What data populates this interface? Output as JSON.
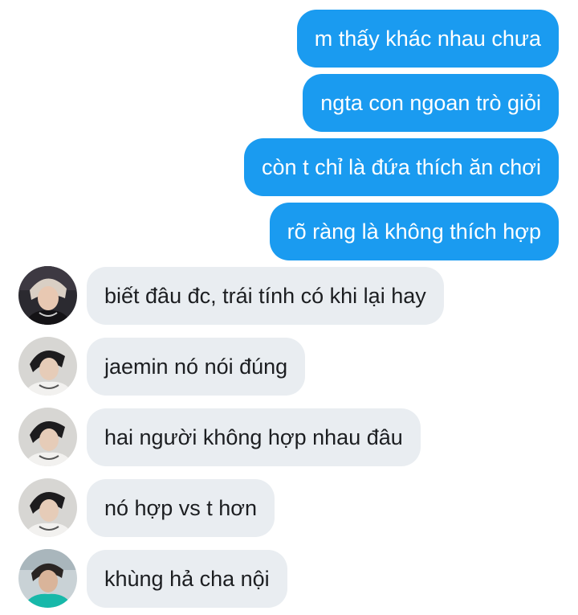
{
  "conversation": {
    "messages": [
      {
        "direction": "sent",
        "text": "m thấy khác nhau chưa"
      },
      {
        "direction": "sent",
        "text": "ngta con ngoan trò giỏi"
      },
      {
        "direction": "sent",
        "text": "còn t chỉ là đứa thích ăn chơi"
      },
      {
        "direction": "sent",
        "text": "rõ ràng là không thích hợp"
      },
      {
        "direction": "received",
        "text": "biết đâu đc, trái tính có khi lại hay",
        "avatar": "profile-photo"
      },
      {
        "direction": "received",
        "text": " jaemin nó nói đúng",
        "avatar": "profile-photo"
      },
      {
        "direction": "received",
        "text": "hai người không hợp nhau đâu",
        "avatar": "profile-photo"
      },
      {
        "direction": "received",
        "text": "nó hợp vs t hơn",
        "avatar": "profile-photo"
      },
      {
        "direction": "received",
        "text": "khùng hả cha nội",
        "avatar": "profile-photo"
      }
    ]
  },
  "colors": {
    "sent_bubble": "#1a9bf0",
    "received_bubble": "#e9edf1",
    "sent_text": "#ffffff",
    "received_text": "#1c1e21"
  }
}
